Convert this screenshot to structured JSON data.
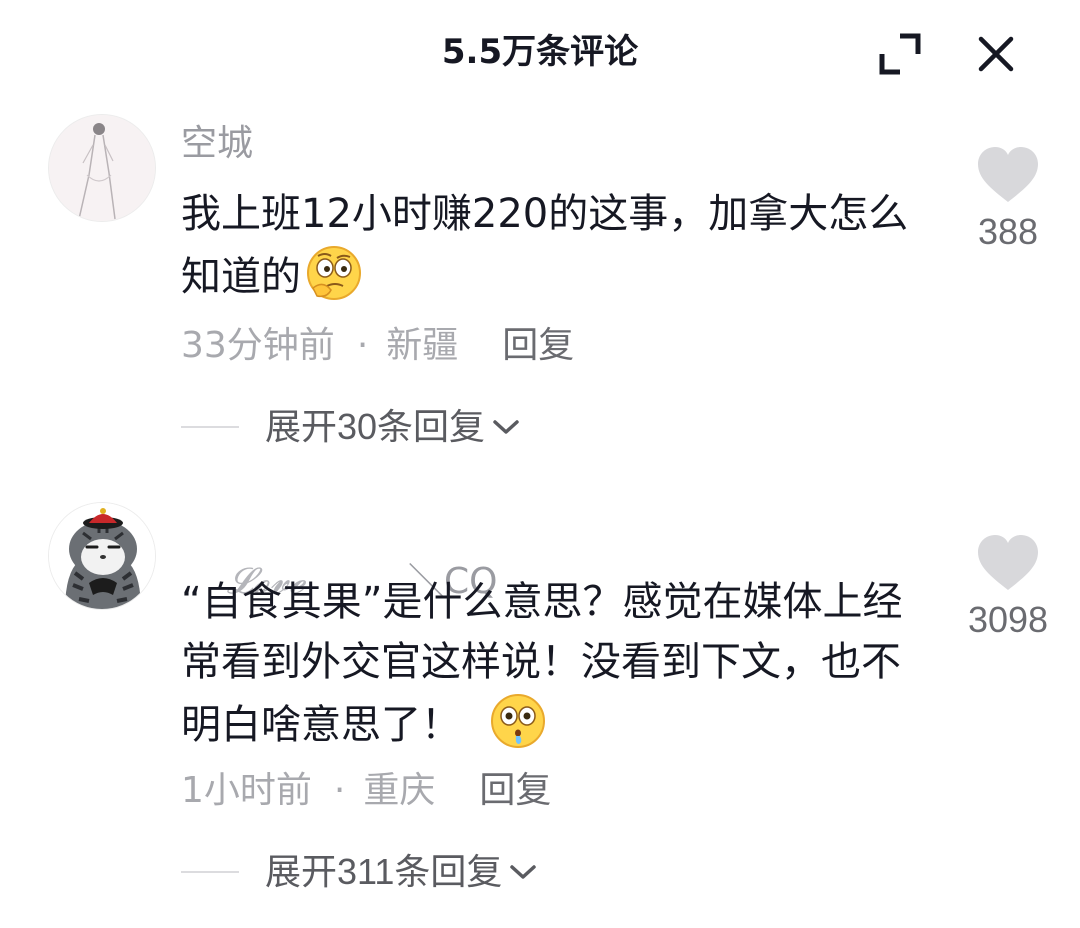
{
  "header": {
    "title": "5.5万条评论"
  },
  "comments": [
    {
      "username": "空城",
      "text": "我上班12小时赚220的这事，加拿大怎么知道的",
      "emoji": "thinking-face",
      "time": "33分钟前",
      "location": "新疆",
      "reply_label": "回复",
      "likes": "388",
      "expand_label": "展开30条回复"
    },
    {
      "username_script": "𝓛𝓸𝓿𝓮",
      "username_rest": "         ＼CQ",
      "text": "“自食其果”是什么意思？感觉在媒体上经常看到外交官这样说！没看到下文，也不明白啥意思了！",
      "emoji": "drooling-confused-face",
      "time": "1小时前",
      "location": "重庆",
      "reply_label": "回复",
      "likes": "3098",
      "expand_label": "展开311条回复"
    }
  ],
  "colors": {
    "text_primary": "#161823",
    "text_secondary": "#a8a9ae",
    "heart": "#d8d8db"
  }
}
